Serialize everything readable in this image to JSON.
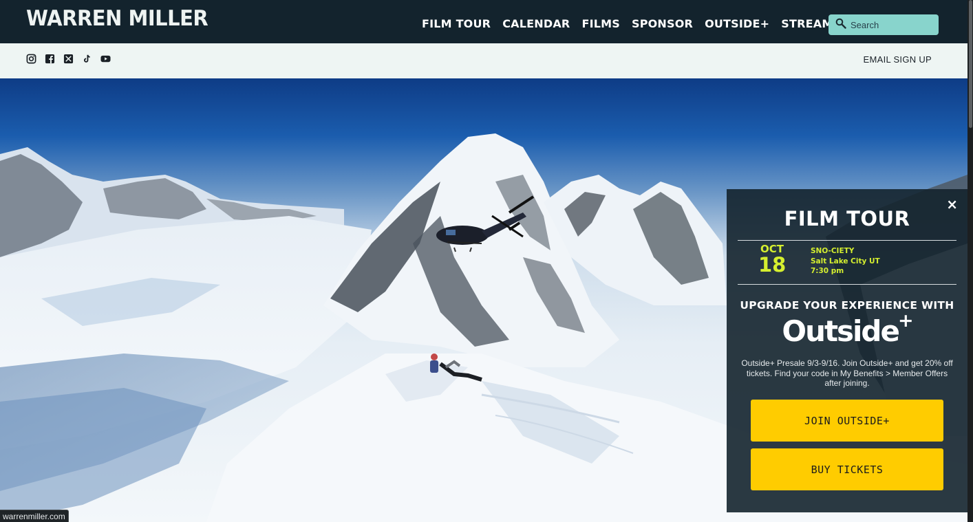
{
  "header": {
    "logo": "WARREN MILLER",
    "nav": [
      "FILM TOUR",
      "CALENDAR",
      "FILMS",
      "SPONSOR",
      "OUTSIDE+",
      "STREAM"
    ],
    "search_placeholder": "Search"
  },
  "subbar": {
    "social_icons": [
      "instagram-icon",
      "facebook-icon",
      "x-icon",
      "tiktok-icon",
      "youtube-icon"
    ],
    "email_signup": "EMAIL SIGN UP"
  },
  "hero": {
    "image": "helicopter-over-snowy-mountain-peaks-with-skier"
  },
  "popup": {
    "close": "×",
    "title": "FILM TOUR",
    "event": {
      "month": "OCT",
      "day": "18",
      "name": "SNO-CIETY",
      "location": "Salt Lake City UT",
      "time": "7:30 pm"
    },
    "upgrade_heading": "UPGRADE YOUR EXPERIENCE WITH",
    "brand": {
      "name": "Outside",
      "plus": "+"
    },
    "promo_text": "Outside+ Presale 9/3-9/16. Join Outside+ and get 20% off tickets. Find your code in My Benefits > Member Offers after joining.",
    "join_button": "JOIN OUTSIDE+",
    "tickets_button": "BUY TICKETS"
  },
  "status_bar": {
    "url": "warrenmiller.com"
  },
  "colors": {
    "header_bg": "#13232d",
    "subbar_bg": "#eef5f3",
    "search_bg": "#88d4cc",
    "event_accent": "#d5ef2f",
    "button_bg": "#ffcc00"
  }
}
